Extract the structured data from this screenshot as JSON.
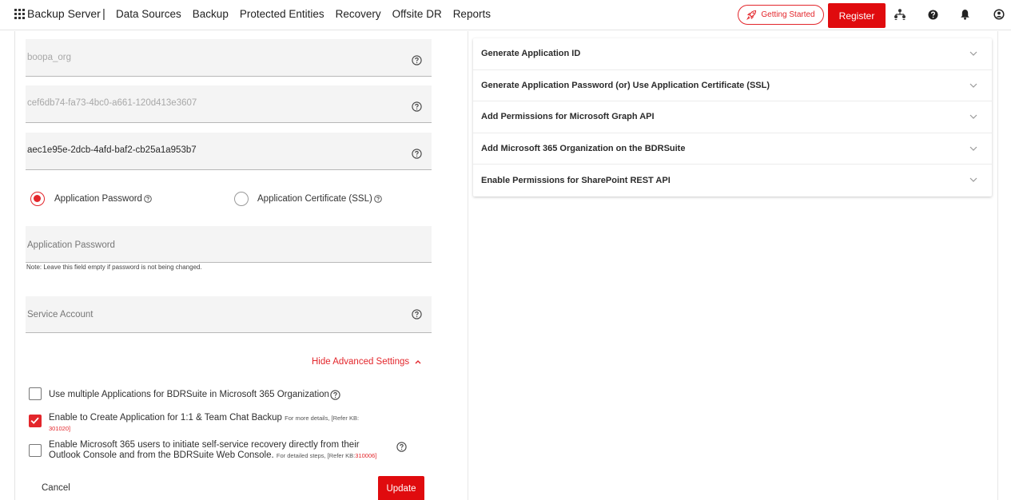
{
  "topbar": {
    "app_name": "Backup Server",
    "separator": "|",
    "nav": [
      "Data Sources",
      "Backup",
      "Protected Entities",
      "Recovery",
      "Offsite DR",
      "Reports"
    ],
    "getting_started": "Getting Started",
    "register": "Register",
    "icons": [
      "apps-grid-icon",
      "org-chart-icon",
      "help-icon",
      "bell-icon",
      "user-icon"
    ]
  },
  "form": {
    "organization_value": "boopa_org",
    "application_id_value": "cef6db74-fa73-4bc0-a661-120d413e3607",
    "tenant_id_value": "aec1e95e-2dcb-4afd-baf2-cb25a1a953b7",
    "auth_options": [
      {
        "label": "Application Password",
        "selected": true
      },
      {
        "label": "Application Certificate (SSL)",
        "selected": false
      }
    ],
    "application_password_placeholder": "Application Password",
    "password_note": "Note: Leave this field empty if password is not being changed.",
    "service_account_placeholder": "Service Account",
    "advanced_toggle": "Hide Advanced Settings",
    "checkboxes": [
      {
        "checked": false,
        "text": "Use multiple Applications for BDRSuite in Microsoft 365 Organization"
      },
      {
        "checked": true,
        "text": "Enable to Create Application for 1:1 & Team Chat Backup",
        "small": "For more details, [Refer KB:",
        "kb_link": "301020",
        "kb_close": "]"
      },
      {
        "checked": false,
        "text_line1": "Enable Microsoft 365 users to initiate self-service recovery directly from their",
        "text_line2": "Outlook Console and from the BDRSuite Web Console.",
        "small": "For detailed steps, [Refer KB:",
        "kb_link": "310006",
        "kb_close": "]"
      }
    ],
    "cancel": "Cancel",
    "update": "Update"
  },
  "guide": {
    "items": [
      "Generate Application ID",
      "Generate Application Password (or) Use Application Certificate (SSL)",
      "Add Permissions for Microsoft Graph API",
      "Add Microsoft 365 Organization on the BDRSuite",
      "Enable Permissions for SharePoint REST API"
    ]
  },
  "colors": {
    "accent": "#e3262b",
    "field_bg": "#f4f4f4"
  }
}
